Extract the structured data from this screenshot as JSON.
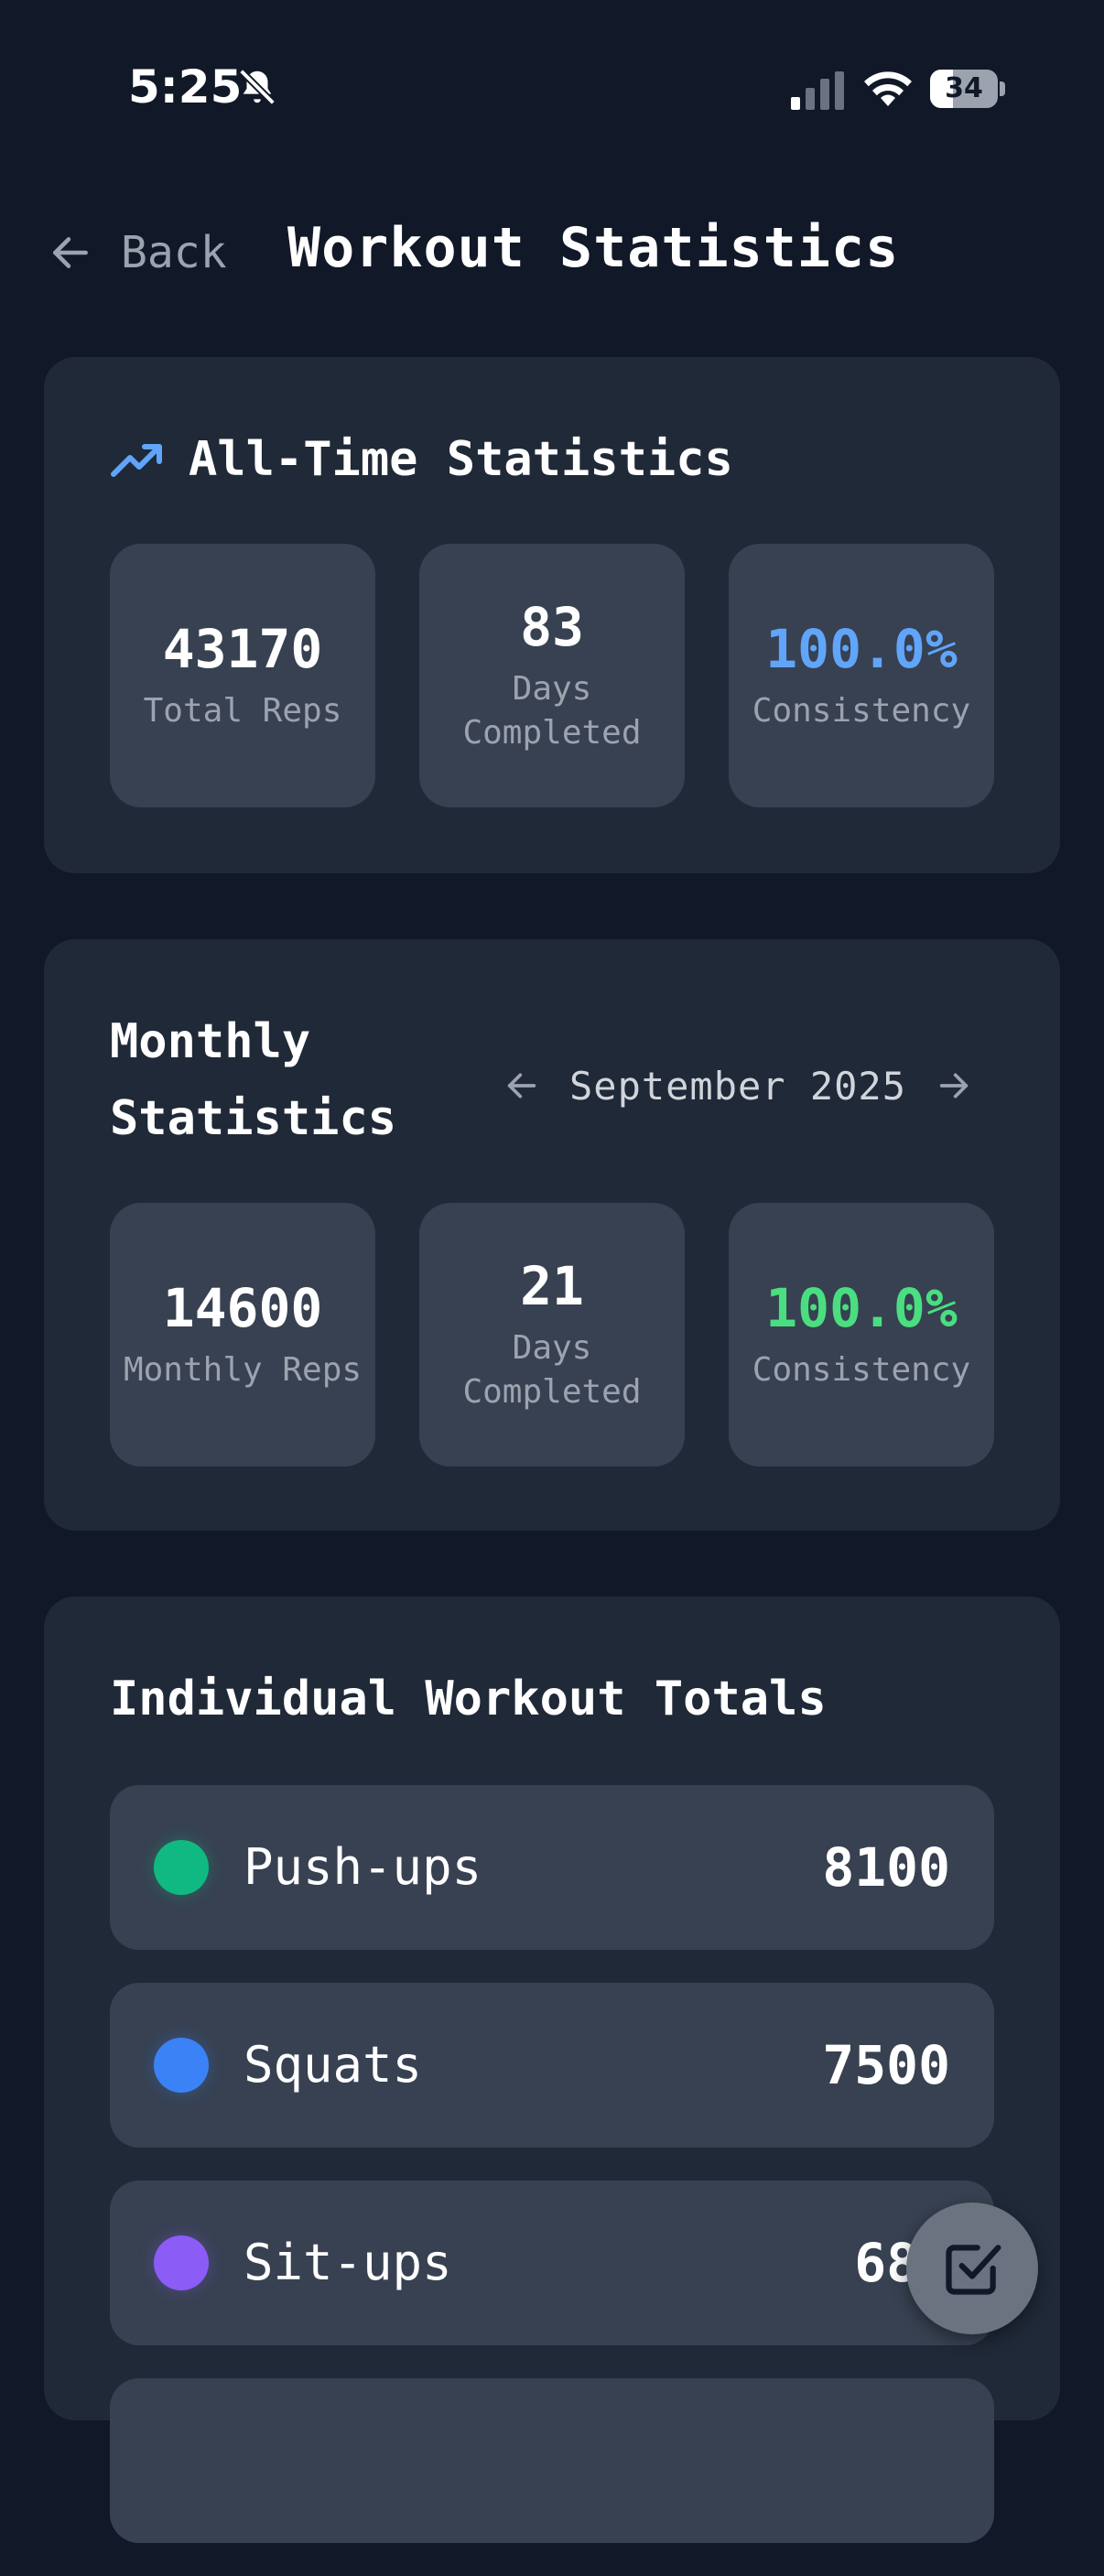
{
  "status_bar": {
    "time": "5:25",
    "battery_level": "34",
    "battery_fraction": 0.34
  },
  "header": {
    "back_label": "Back",
    "title": "Workout Statistics"
  },
  "all_time": {
    "title": "All-Time Statistics",
    "total_reps": "43170",
    "total_reps_label": "Total Reps",
    "days_completed": "83",
    "days_completed_label": "Days Completed",
    "consistency": "100.0%",
    "consistency_label": "Consistency"
  },
  "monthly": {
    "title": "Monthly Statistics",
    "month": "September 2025",
    "monthly_reps": "14600",
    "monthly_reps_label": "Monthly Reps",
    "days_completed": "21",
    "days_completed_label": "Days Completed",
    "consistency": "100.0%",
    "consistency_label": "Consistency"
  },
  "workouts": {
    "title": "Individual Workout Totals",
    "items": [
      {
        "name": "Push-ups",
        "count": "8100",
        "color": "#10b981"
      },
      {
        "name": "Squats",
        "count": "7500",
        "color": "#3b82f6"
      },
      {
        "name": "Sit-ups",
        "count": "680",
        "color": "#8b5cf6"
      }
    ]
  },
  "colors": {
    "background": "#111827",
    "card": "#1f2937",
    "tile": "#374151",
    "accent_blue": "#60a5fa",
    "accent_green": "#4ade80"
  },
  "icons": {
    "back": "arrow-left-icon",
    "trend": "trending-up-icon",
    "prev_month": "arrow-left-icon",
    "next_month": "arrow-right-icon",
    "fab": "check-square-icon"
  }
}
